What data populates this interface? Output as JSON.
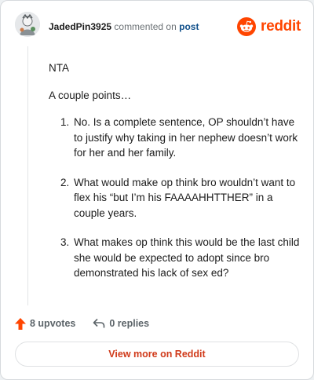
{
  "header": {
    "username": "JadedPin3925",
    "action_text": "commented on",
    "link_text": "post",
    "brand": "reddit"
  },
  "comment": {
    "paragraphs": [
      "NTA",
      "A couple points…"
    ],
    "points": [
      "No. Is a complete sentence, OP shouldn’t have to justify why taking in her nephew doesn’t work for her and her family.",
      "What would make op think bro wouldn’t want to flex his “but I’m his FAAAAHHTTHER” in a couple years.",
      "What makes op think this would be the last child she would be expected to adopt since bro demonstrated his lack of sex ed?"
    ]
  },
  "footer": {
    "upvotes": "8 upvotes",
    "replies": "0 replies",
    "icons": [
      "upvote-arrow-icon",
      "reply-arrow-icon"
    ]
  },
  "cta": {
    "label": "View more on Reddit"
  },
  "colors": {
    "brand": "#ff4500",
    "upvote": "#ff4500",
    "link": "#0f4f8a",
    "cta_text": "#d03a1a"
  }
}
